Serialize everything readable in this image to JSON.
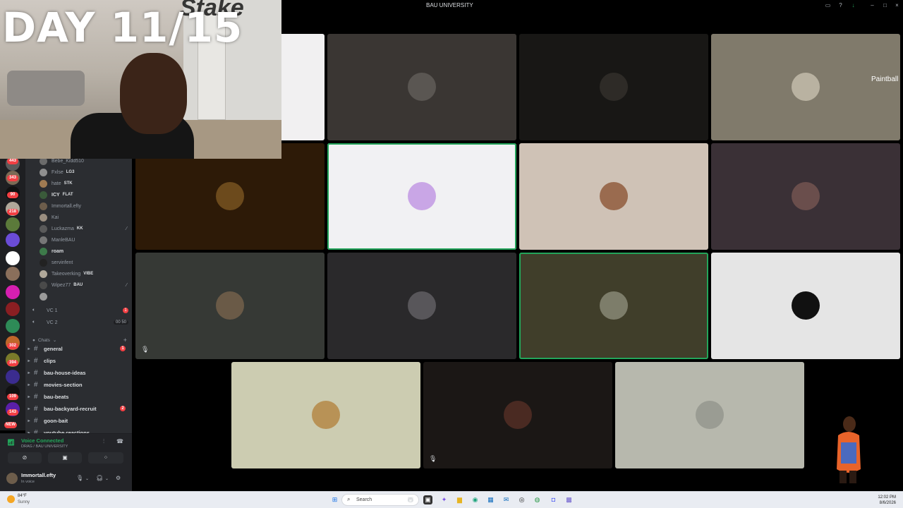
{
  "window": {
    "title": "BAU UNIVERSITY"
  },
  "overlay": {
    "day_counter": "DAY 11/15",
    "brand_logo": "Stake",
    "side_label": "Paintball"
  },
  "servers": {
    "badges": [
      "443",
      "343",
      "90",
      "218",
      "NEW"
    ],
    "badges_lower": [
      "302",
      "394",
      "109",
      "143"
    ]
  },
  "members": [
    {
      "name": "Bebe_Kidd510",
      "tag": "",
      "online": false
    },
    {
      "name": "Fxlse",
      "tag": "LG3",
      "online": false
    },
    {
      "name": "hate",
      "tag": "STK",
      "online": false
    },
    {
      "name": "ICY",
      "tag": "FLAT",
      "online": true
    },
    {
      "name": "Immortall.efty",
      "tag": "",
      "online": false
    },
    {
      "name": "Kai",
      "tag": "",
      "online": false
    },
    {
      "name": "Luckazma",
      "tag": "KK",
      "online": false
    },
    {
      "name": "ManleBAU",
      "tag": "",
      "online": false
    },
    {
      "name": "roam",
      "tag": "",
      "online": true
    },
    {
      "name": "servinfent",
      "tag": "",
      "online": false
    },
    {
      "name": "Takeoverking",
      "tag": "VIBE",
      "online": false
    },
    {
      "name": "Wipez77",
      "tag": "BAU",
      "online": false
    }
  ],
  "voice_channels": [
    {
      "name": "VC 1",
      "badge": "1"
    },
    {
      "name": "VC 2",
      "pill": "00  50"
    }
  ],
  "category": {
    "name": "Chats"
  },
  "channels": [
    {
      "name": "general",
      "badge": "1"
    },
    {
      "name": "clips",
      "badge": ""
    },
    {
      "name": "bau-house-ideas",
      "badge": ""
    },
    {
      "name": "movies-section",
      "badge": ""
    },
    {
      "name": "bau-beats",
      "badge": ""
    },
    {
      "name": "bau-backyard-recruit",
      "badge": "2"
    },
    {
      "name": "goon-bait",
      "badge": ""
    },
    {
      "name": "youtube-reactions",
      "badge": ""
    }
  ],
  "voice_panel": {
    "status": "Voice Connected",
    "location": "DRAG / BAU UNIVERSITY"
  },
  "user_panel": {
    "username": "Immortall.efty",
    "status": "In voice"
  },
  "tiles": [
    {
      "bg": "#f1f0f1",
      "avatar": "#f1f0f1",
      "speaking": false
    },
    {
      "bg": "#3a3633",
      "avatar": "#5a5652",
      "speaking": false
    },
    {
      "bg": "#181715",
      "avatar": "#2e2b27",
      "speaking": false
    },
    {
      "bg": "#807a6b",
      "avatar": "#b9b2a1",
      "speaking": false
    },
    {
      "bg": "#2d1a07",
      "avatar": "#6c4a1c",
      "speaking": false
    },
    {
      "bg": "#f1f1f3",
      "avatar": "#c9a6e6",
      "speaking": true
    },
    {
      "bg": "#cfc2b6",
      "avatar": "#9a6b4f",
      "speaking": false
    },
    {
      "bg": "#3a3036",
      "avatar": "#6a4e4c",
      "speaking": false
    },
    {
      "bg": "#363935",
      "avatar": "#6a5a47",
      "speaking": false,
      "muted": true
    },
    {
      "bg": "#2a292b",
      "avatar": "#58565a",
      "speaking": false
    },
    {
      "bg": "#403e2a",
      "avatar": "#7d7d6a",
      "speaking": true
    },
    {
      "bg": "#e5e5e5",
      "avatar": "#111111",
      "speaking": false
    },
    {
      "bg": "#ccccb1",
      "avatar": "#b89256",
      "speaking": false
    },
    {
      "bg": "#1b1715",
      "avatar": "#4a2a22",
      "speaking": false,
      "muted": true
    },
    {
      "bg": "#b7b8ad",
      "avatar": "#9a9c93",
      "speaking": false
    }
  ],
  "taskbar": {
    "weather_temp": "84°F",
    "weather_cond": "Sunny",
    "search_placeholder": "Search",
    "time": "12:02 PM",
    "date": "8/6/2026"
  },
  "colors": {
    "discord_bg": "#2b2d31",
    "rail_bg": "#1e1f22",
    "green": "#23a55a",
    "red_badge": "#f23f43"
  }
}
